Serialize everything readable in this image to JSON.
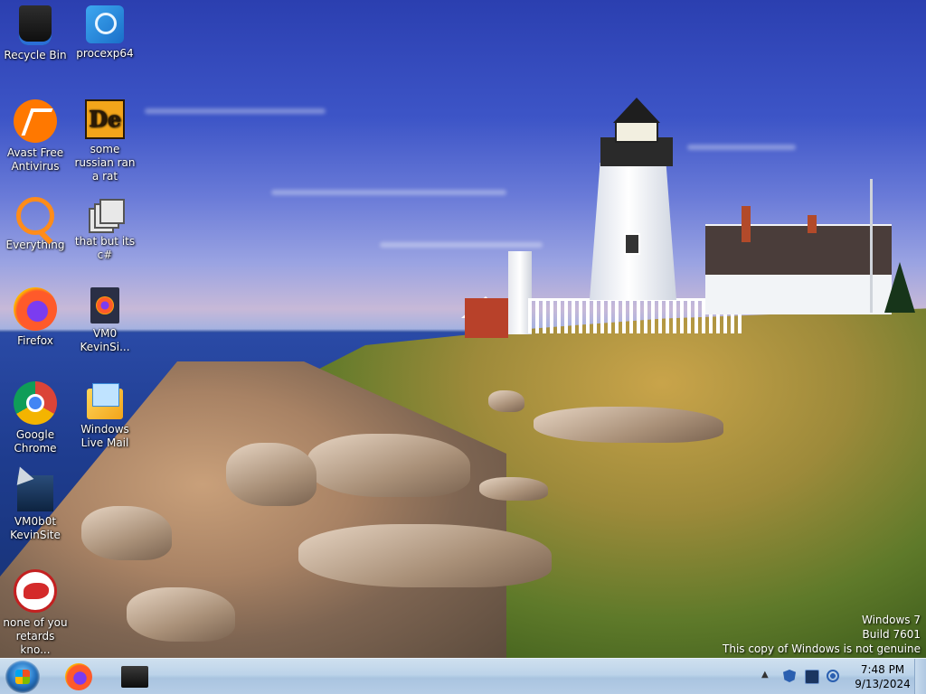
{
  "desktop": {
    "icons": [
      {
        "label": "Recycle Bin",
        "icon": "recycle-bin-icon"
      },
      {
        "label": "procexp64",
        "icon": "process-explorer-icon"
      },
      {
        "label": "Avast Free Antivirus",
        "icon": "avast-icon"
      },
      {
        "label": "some russian ran a rat",
        "icon": "de-icon"
      },
      {
        "label": "Everything",
        "icon": "everything-search-icon"
      },
      {
        "label": "that but its c#",
        "icon": "stacked-windows-icon"
      },
      {
        "label": "Firefox",
        "icon": "firefox-icon"
      },
      {
        "label": "VM0 KevinSi...",
        "icon": "firefox-document-icon"
      },
      {
        "label": "Google Chrome",
        "icon": "chrome-icon"
      },
      {
        "label": "Windows Live Mail",
        "icon": "windows-live-mail-icon"
      },
      {
        "label": "VM0b0t KevinSite",
        "icon": "vm-shortcut-icon"
      },
      {
        "label": "none of you retards kno...",
        "icon": "red-rat-icon"
      }
    ]
  },
  "watermark": {
    "line1": "Windows 7",
    "line2": "Build 7601",
    "line3": "This copy of Windows is not genuine"
  },
  "taskbar": {
    "pinned": [
      "firefox-icon",
      "vm-console-icon"
    ],
    "tray": {
      "overflow_glyph": "▲",
      "icons": [
        "shield-icon",
        "network-icon",
        "volume-icon"
      ],
      "time": "7:48 PM",
      "date": "9/13/2024"
    }
  },
  "colors": {
    "taskbar_bg": "#bcd3e9",
    "desktop_sky": "#3d55c7"
  }
}
